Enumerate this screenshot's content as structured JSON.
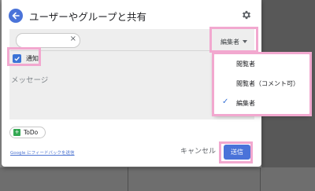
{
  "dialog": {
    "title": "ユーザーやグループと共有",
    "back_icon": "arrow-left-icon",
    "settings_icon": "gear-icon",
    "chip_close": "×",
    "role": {
      "label": "編集者"
    },
    "notify": {
      "label": "通知",
      "checked": true
    },
    "message_placeholder": "メッセージ",
    "todo_label": "ToDo",
    "feedback_link": "Google にフィードバックを送信",
    "cancel_label": "キャンセル",
    "send_label": "送信"
  },
  "role_menu": {
    "items": [
      {
        "label": "閲覧者",
        "selected": false
      },
      {
        "label": "閲覧者（コメント可）",
        "selected": false
      },
      {
        "label": "編集者",
        "selected": true
      }
    ],
    "check_glyph": "✓"
  },
  "colors": {
    "accent": "#4a73d9",
    "highlight": "#f2a8cf"
  }
}
